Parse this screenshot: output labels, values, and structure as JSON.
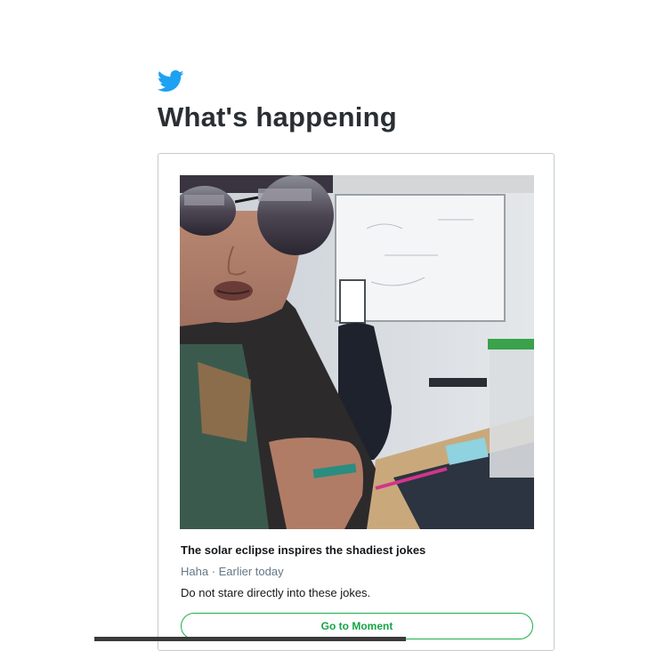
{
  "header": {
    "logo_icon": "twitter-bird-icon",
    "title": "What's happening"
  },
  "moment": {
    "image_icon": "photo",
    "headline": "The solar eclipse inspires the shadiest jokes",
    "meta": "Haha · Earlier today",
    "description": "Do not stare directly into these jokes.",
    "cta_label": "Go to Moment"
  },
  "colors": {
    "brand_blue": "#1da1f2",
    "cta_green": "#17a447",
    "border": "#c4cbd0"
  }
}
